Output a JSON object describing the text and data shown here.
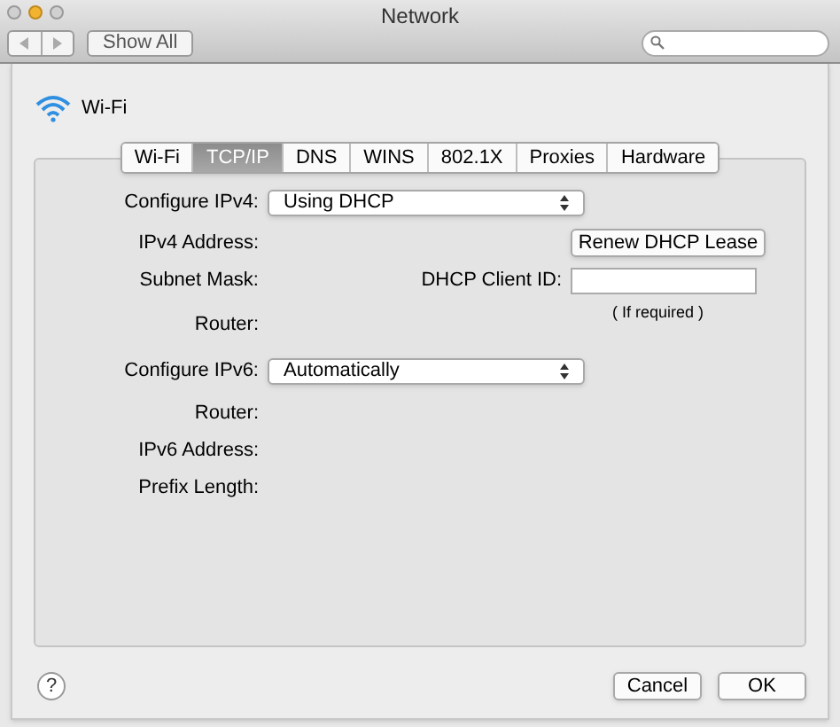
{
  "window": {
    "title": "Network"
  },
  "toolbar": {
    "show_all": "Show All"
  },
  "service": {
    "name": "Wi-Fi"
  },
  "tabs": [
    {
      "label": "Wi-Fi",
      "selected": false
    },
    {
      "label": "TCP/IP",
      "selected": true
    },
    {
      "label": "DNS",
      "selected": false
    },
    {
      "label": "WINS",
      "selected": false
    },
    {
      "label": "802.1X",
      "selected": false
    },
    {
      "label": "Proxies",
      "selected": false
    },
    {
      "label": "Hardware",
      "selected": false
    }
  ],
  "ipv4": {
    "configure_label": "Configure IPv4:",
    "configure_value": "Using DHCP",
    "rows": [
      "IPv4 Address:",
      "Subnet Mask:",
      "Router:"
    ],
    "renew_button": "Renew DHCP Lease",
    "client_id_label": "DHCP Client ID:",
    "client_id_hint": "( If required )"
  },
  "ipv6": {
    "configure_label": "Configure IPv6:",
    "configure_value": "Automatically",
    "rows": [
      "Router:",
      "IPv6 Address:",
      "Prefix Length:"
    ]
  },
  "buttons": {
    "help": "?",
    "cancel": "Cancel",
    "ok": "OK"
  }
}
